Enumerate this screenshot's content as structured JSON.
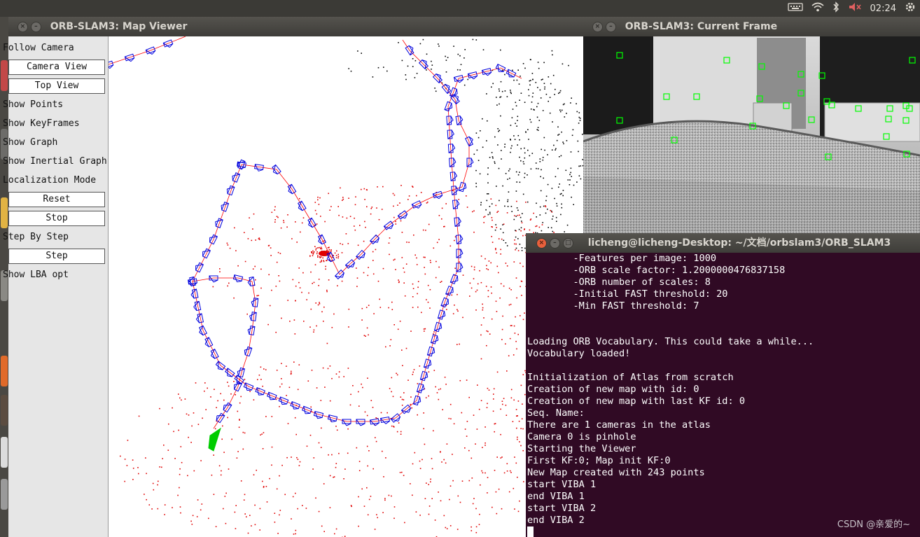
{
  "system": {
    "clock": "02:24",
    "tray_icons": [
      "keyboard-icon",
      "wifi-icon",
      "bluetooth-icon",
      "volume-muted-icon",
      "settings-gear-icon"
    ]
  },
  "map_viewer": {
    "title": "ORB-SLAM3: Map Viewer",
    "controls": [
      {
        "type": "checkbox",
        "label": "Follow Camera"
      },
      {
        "type": "button",
        "label": "Camera View"
      },
      {
        "type": "button",
        "label": "Top View"
      },
      {
        "type": "checkbox",
        "label": "Show Points"
      },
      {
        "type": "checkbox",
        "label": "Show KeyFrames"
      },
      {
        "type": "checkbox",
        "label": "Show Graph"
      },
      {
        "type": "checkbox",
        "label": "Show Inertial Graph"
      },
      {
        "type": "checkbox",
        "label": "Localization Mode"
      },
      {
        "type": "button",
        "label": "Reset"
      },
      {
        "type": "button",
        "label": "Stop"
      },
      {
        "type": "checkbox",
        "label": "Step By Step"
      },
      {
        "type": "button",
        "label": "Step"
      },
      {
        "type": "checkbox",
        "label": "Show LBA opt"
      }
    ],
    "colors": {
      "points": "#e00000",
      "ref_points": "#000000",
      "keyframes": "#0000dd",
      "graph": "#ff0000",
      "current_camera": "#00cc00"
    }
  },
  "current_frame": {
    "title": "ORB-SLAM3: Current Frame",
    "feature_color": "#00ff00"
  },
  "terminal": {
    "title": "licheng@licheng-Desktop: ~/文档/orbslam3/ORB_SLAM3",
    "lines": [
      "        -Features per image: 1000",
      "        -ORB scale factor: 1.2000000476837158",
      "        -ORB number of scales: 8",
      "        -Initial FAST threshold: 20",
      "        -Min FAST threshold: 7",
      "",
      "",
      "Loading ORB Vocabulary. This could take a while...",
      "Vocabulary loaded!",
      "",
      "Initialization of Atlas from scratch",
      "Creation of new map with id: 0",
      "Creation of new map with last KF id: 0",
      "Seq. Name: ",
      "There are 1 cameras in the atlas",
      "Camera 0 is pinhole",
      "Starting the Viewer",
      "First KF:0; Map init KF:0",
      "New Map created with 243 points",
      "start VIBA 1",
      "end VIBA 1",
      "start VIBA 2",
      "end VIBA 2"
    ],
    "bg_color": "#300a24"
  },
  "watermark": "CSDN @亲爱的~"
}
